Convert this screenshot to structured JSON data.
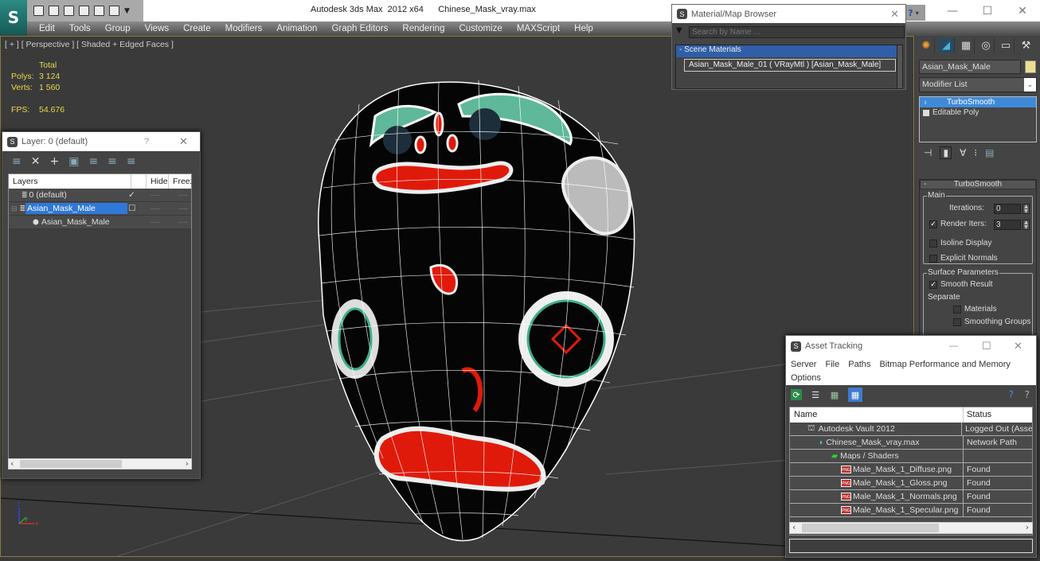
{
  "app": {
    "title": "Autodesk 3ds Max  2012 x64",
    "file": "Chinese_Mask_vray.max",
    "logo_glyph": "S",
    "quick_access": [
      "open-icon",
      "save-icon",
      "new-icon",
      "project-icon",
      "undo-icon",
      "redo-icon"
    ],
    "window_controls": {
      "minimize": "—",
      "maximize": "☐",
      "close": "✕"
    },
    "help_glyph": "?"
  },
  "menu": [
    "Edit",
    "Tools",
    "Group",
    "Views",
    "Create",
    "Modifiers",
    "Animation",
    "Graph Editors",
    "Rendering",
    "Customize",
    "MAXScript",
    "Help"
  ],
  "viewport": {
    "label": "[ + ] [ Perspective ] [ Shaded + Edged Faces ]",
    "stats": {
      "total_label": "Total",
      "polys_label": "Polys:",
      "polys_value": "3 124",
      "verts_label": "Verts:",
      "verts_value": "1 560",
      "fps_label": "FPS:",
      "fps_value": "54.676"
    },
    "axis": {
      "z": "z",
      "y": "y",
      "x": "x"
    }
  },
  "layer_dialog": {
    "title": "Layer: 0 (default)",
    "help": "?",
    "close": "✕",
    "toolbar": [
      "create-layer-icon",
      "delete-icon",
      "add-icon",
      "select-objects-icon",
      "highlight-icon",
      "hide-all-icon",
      "freeze-all-icon"
    ],
    "toolbar_glyphs": [
      "≡",
      "✕",
      "+",
      "▣",
      "≡",
      "≡",
      "≡"
    ],
    "columns": [
      "Layers",
      "",
      "Hide",
      "Freeze"
    ],
    "rows": [
      {
        "name": "0 (default)",
        "active": "✓",
        "hide": "----",
        "freeze": "----"
      },
      {
        "name": "Asian_Mask_Male",
        "active": "☐",
        "hide": "----",
        "freeze": "----",
        "expander": "⊟"
      },
      {
        "name": "Asian_Mask_Male",
        "active": "",
        "hide": "----",
        "freeze": "----"
      }
    ],
    "scroll_left": "‹",
    "scroll_right": "›"
  },
  "material_browser": {
    "title": "Material/Map Browser",
    "close": "✕",
    "search_placeholder": "Search by Name ...",
    "section": "- Scene Materials",
    "items": [
      "Asian_Mask_Male_01  ( VRayMtl )  [Asian_Mask_Male]"
    ]
  },
  "command_panel": {
    "tabs": [
      "create-icon",
      "modify-icon",
      "hierarchy-icon",
      "motion-icon",
      "display-icon",
      "utilities-icon"
    ],
    "tab_glyphs": [
      "✺",
      "◢",
      "▦",
      "◎",
      "▭",
      "⚒"
    ],
    "object_name": "Asian_Mask_Male",
    "object_color": "#ece08f",
    "modifier_list": "Modifier List",
    "stack": [
      {
        "name": "TurboSmooth",
        "selected": true,
        "icon": "💡"
      },
      {
        "name": "Editable Poly",
        "selected": false,
        "icon": "■"
      }
    ],
    "stack_tools": [
      "pin-stack-icon",
      "show-end-result-icon",
      "make-unique-icon",
      "remove-modifier-icon",
      "configure-sets-icon"
    ],
    "stack_glyphs": [
      "⊣",
      "▮",
      "∀",
      "⁝",
      "▤"
    ],
    "turbosmooth": {
      "title": "TurboSmooth",
      "collapse": "-",
      "main_group": "Main",
      "iterations_label": "Iterations:",
      "iterations_value": "0",
      "render_iters_label": "Render Iters:",
      "render_iters_value": "3",
      "render_iters_checked": true,
      "isoline_label": "Isoline Display",
      "isoline_checked": false,
      "explicit_normals_label": "Explicit Normals",
      "explicit_normals_checked": false,
      "surface_group": "Surface Parameters",
      "smooth_result_label": "Smooth Result",
      "smooth_result_checked": true,
      "separate_label": "Separate",
      "materials_label": "Materials",
      "materials_checked": false,
      "smoothing_groups_label": "Smoothing Groups",
      "smoothing_groups_checked": false
    }
  },
  "asset_tracking": {
    "title": "Asset Tracking",
    "controls": {
      "minimize": "—",
      "maximize": "☐",
      "close": "✕"
    },
    "menu": [
      "Server",
      "File",
      "Paths",
      "Bitmap Performance and Memory",
      "Options"
    ],
    "toolbar": [
      "refresh-icon",
      "list-icon",
      "thumbnail-icon",
      "table-view-icon"
    ],
    "columns": [
      "Name",
      "Status"
    ],
    "rows": [
      {
        "name": "Autodesk Vault 2012",
        "status": "Logged Out (Asse",
        "indent": 1,
        "icon": "vault"
      },
      {
        "name": "Chinese_Mask_vray.max",
        "status": "Network Path",
        "indent": 2,
        "icon": "max"
      },
      {
        "name": "Maps / Shaders",
        "status": "",
        "indent": 3,
        "icon": "maps"
      },
      {
        "name": "Male_Mask_1_Diffuse.png",
        "status": "Found",
        "indent": 4,
        "icon": "png"
      },
      {
        "name": "Male_Mask_1_Gloss.png",
        "status": "Found",
        "indent": 4,
        "icon": "png"
      },
      {
        "name": "Male_Mask_1_Normals.png",
        "status": "Found",
        "indent": 4,
        "icon": "png"
      },
      {
        "name": "Male_Mask_1_Specular.png",
        "status": "Found",
        "indent": 4,
        "icon": "png"
      }
    ],
    "scroll_left": "‹",
    "scroll_right": "›"
  }
}
